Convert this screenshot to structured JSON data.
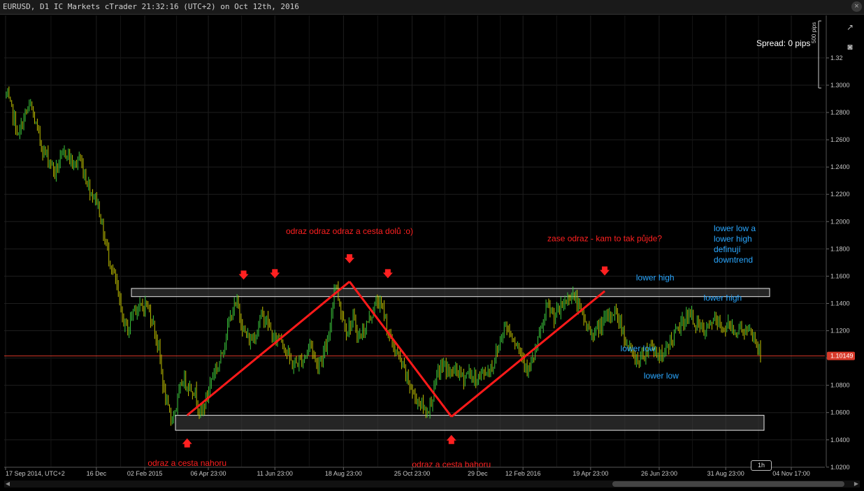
{
  "window": {
    "title": "EURUSD, D1 IC Markets cTrader 21:32:16 (UTC+2) on Oct 12th, 2016"
  },
  "chart_data": {
    "type": "candlestick",
    "symbol": "EURUSD",
    "timeframe_indicator": "1h",
    "spread_text": "Spread: 0 pips",
    "scale_text": "500 pips",
    "current_price": "1.10149",
    "ylim": [
      1.01,
      1.34
    ],
    "y_ticks": [
      "1.32",
      "1.3000",
      "1.2800",
      "1.2600",
      "1.2400",
      "1.2200",
      "1.2000",
      "1.1800",
      "1.1600",
      "1.1400",
      "1.1200",
      "1.1000",
      "1.0800",
      "1.0600",
      "1.0400",
      "1.0200"
    ],
    "x_ticks": [
      "17 Sep 2014, UTC+2",
      "16 Dec",
      "02 Feb 2015",
      "06 Apr 23:00",
      "11 Jun 23:00",
      "18 Aug 23:00",
      "25 Oct 23:00",
      "29 Dec",
      "12 Feb 2016",
      "19 Apr 23:00",
      "26 Jun 23:00",
      "31 Aug 23:00",
      "04 Nov 17:00"
    ],
    "price_path": [
      1.293,
      1.28,
      1.262,
      1.278,
      1.285,
      1.268,
      1.253,
      1.246,
      1.236,
      1.246,
      1.252,
      1.24,
      1.247,
      1.233,
      1.221,
      1.215,
      1.19,
      1.172,
      1.155,
      1.13,
      1.12,
      1.138,
      1.136,
      1.14,
      1.128,
      1.108,
      1.073,
      1.055,
      1.065,
      1.085,
      1.08,
      1.075,
      1.058,
      1.072,
      1.09,
      1.095,
      1.115,
      1.133,
      1.14,
      1.12,
      1.112,
      1.118,
      1.132,
      1.126,
      1.112,
      1.118,
      1.105,
      1.095,
      1.097,
      1.1,
      1.112,
      1.095,
      1.102,
      1.112,
      1.158,
      1.135,
      1.12,
      1.128,
      1.115,
      1.122,
      1.132,
      1.142,
      1.135,
      1.115,
      1.105,
      1.095,
      1.084,
      1.072,
      1.068,
      1.06,
      1.07,
      1.09,
      1.095,
      1.088,
      1.092,
      1.085,
      1.09,
      1.084,
      1.088,
      1.09,
      1.095,
      1.11,
      1.125,
      1.118,
      1.11,
      1.1,
      1.09,
      1.105,
      1.122,
      1.138,
      1.13,
      1.135,
      1.142,
      1.148,
      1.138,
      1.128,
      1.118,
      1.12,
      1.125,
      1.13,
      1.135,
      1.125,
      1.11,
      1.102,
      1.098,
      1.105,
      1.11,
      1.104,
      1.1,
      1.112,
      1.118,
      1.125,
      1.132,
      1.128,
      1.122,
      1.118,
      1.128,
      1.125,
      1.122,
      1.124,
      1.12,
      1.122,
      1.118,
      1.115,
      1.102
    ],
    "levels": [
      {
        "name": "resistance zone",
        "top": 1.151,
        "bottom": 1.145
      },
      {
        "name": "support zone",
        "top": 1.058,
        "bottom": 1.047
      },
      {
        "name": "current price line",
        "value": 1.10149
      }
    ],
    "zigzag": [
      {
        "date": "2015-03-16",
        "price": 1.058
      },
      {
        "date": "2015-08-24",
        "price": 1.156
      },
      {
        "date": "2015-12-03",
        "price": 1.057
      },
      {
        "date": "2016-05-03",
        "price": 1.149
      }
    ],
    "annotations": {
      "top_left": "odraz odraz odraz a cesta dolů :o)",
      "top_right": "zase odraz - kam to tak půjde?",
      "bottom_left": "odraz a cesta nahoru",
      "bottom_mid": "odraz a cesta bahoru",
      "lower_high_1": "lower high",
      "lower_high_2": "lower high",
      "lower_low_1": "lower low",
      "lower_low_2": "lower low",
      "trend_note": [
        "lower low a",
        "lower high",
        "definují",
        "downtrend"
      ]
    },
    "colors": {
      "background": "#000000",
      "bull": "#3cc83c",
      "bear": "#c0c000",
      "annotation_red": "#ff2020",
      "annotation_blue": "#2aa7ff",
      "price_line": "#d83a2a",
      "zone": "#444444"
    }
  },
  "controls": {
    "close_label": "×",
    "expand_icon": "↗",
    "camera_icon": "◙"
  }
}
